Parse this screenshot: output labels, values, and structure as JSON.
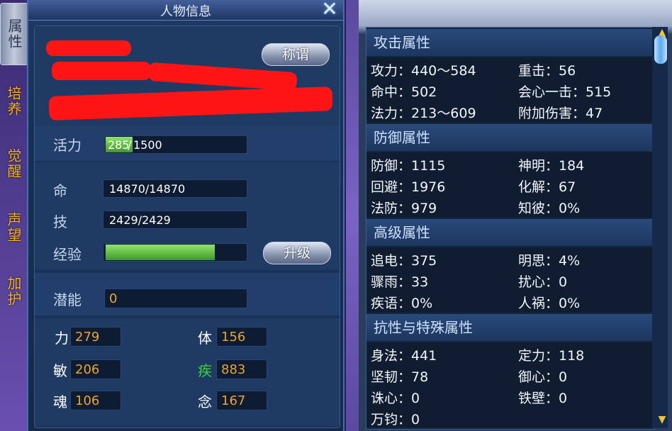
{
  "side_tabs": [
    {
      "label": "属性",
      "active": true
    },
    {
      "label": "培养",
      "active": false
    },
    {
      "label": "觉醒",
      "active": false
    },
    {
      "label": "声望",
      "active": false
    },
    {
      "label": "加护",
      "active": false
    }
  ],
  "window": {
    "title": "人物信息"
  },
  "icons": {
    "close": "close-icon",
    "scroll_up": "arrow-up-icon",
    "scroll_down": "arrow-down-icon"
  },
  "buttons": {
    "title_btn": "称谓",
    "upgrade_btn": "升级"
  },
  "vitality": {
    "label": "活力",
    "current": "285",
    "slash": "/",
    "max": "1500",
    "fill_fraction": 0.19
  },
  "hp": {
    "label": "命",
    "value": "14870/14870"
  },
  "skill": {
    "label": "技",
    "value": "2429/2429"
  },
  "experience": {
    "label": "经验",
    "fill_fraction": 0.78
  },
  "potential": {
    "label": "潜能",
    "value": "0"
  },
  "stats": [
    {
      "label": "力",
      "value": "279",
      "label_color": "#ffffff"
    },
    {
      "label": "体",
      "value": "156",
      "label_color": "#ffffff"
    },
    {
      "label": "敏",
      "value": "206",
      "label_color": "#ffffff"
    },
    {
      "label": "疾",
      "value": "883",
      "label_color": "#37d43a"
    },
    {
      "label": "魂",
      "value": "106",
      "label_color": "#ffffff"
    },
    {
      "label": "念",
      "value": "167",
      "label_color": "#ffffff"
    }
  ],
  "sections": [
    {
      "title": "攻击属性",
      "attrs": [
        "攻力：440～584",
        "重击：56",
        "命中：502",
        "会心一击：515",
        "法力：213～609",
        "附加伤害：47"
      ]
    },
    {
      "title": "防御属性",
      "attrs": [
        "防御：1115",
        "神明：184",
        "回避：1976",
        "化解：67",
        "法防：979",
        "知彼：0%"
      ]
    },
    {
      "title": "高级属性",
      "attrs": [
        "追电：375",
        "明思：4%",
        "骤雨：33",
        "扰心：0",
        "疾语：0%",
        "人祸：0%"
      ]
    },
    {
      "title": "抗性与特殊属性",
      "attrs": [
        "身法：441",
        "定力：118",
        "坚韧：78",
        "御心：0",
        "诛心：0",
        "铁壁：0",
        "万钧：0"
      ]
    }
  ],
  "colors": {
    "stat_value": "#e8a53a",
    "accent_green": "#37d43a",
    "redaction": "#ff1515"
  }
}
